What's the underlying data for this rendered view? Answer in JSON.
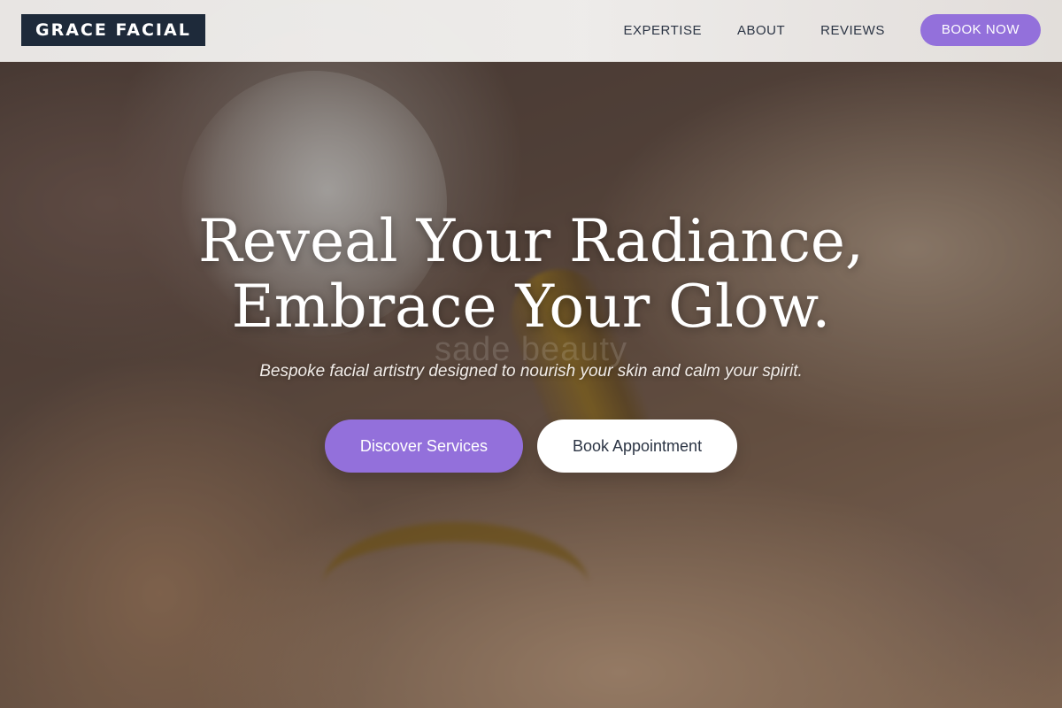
{
  "brand": {
    "logo_text": "GRACE FACIAL"
  },
  "nav": {
    "links": [
      {
        "label": "EXPERTISE"
      },
      {
        "label": "ABOUT"
      },
      {
        "label": "REVIEWS"
      }
    ],
    "cta_label": "BOOK NOW"
  },
  "hero": {
    "title_line_1": "Reveal Your Radiance,",
    "title_line_2": "Embrace Your Glow.",
    "subtitle": "Bespoke facial artistry designed to nourish your skin and calm your spirit.",
    "watermark": "sade beauty",
    "primary_button": "Discover Services",
    "secondary_button": "Book Appointment",
    "image_description": "blurred close-up of an oil dropper over skin"
  },
  "colors": {
    "accent": "#9370db",
    "logo_background": "#1e2a3a",
    "nav_text": "#2b3444"
  }
}
